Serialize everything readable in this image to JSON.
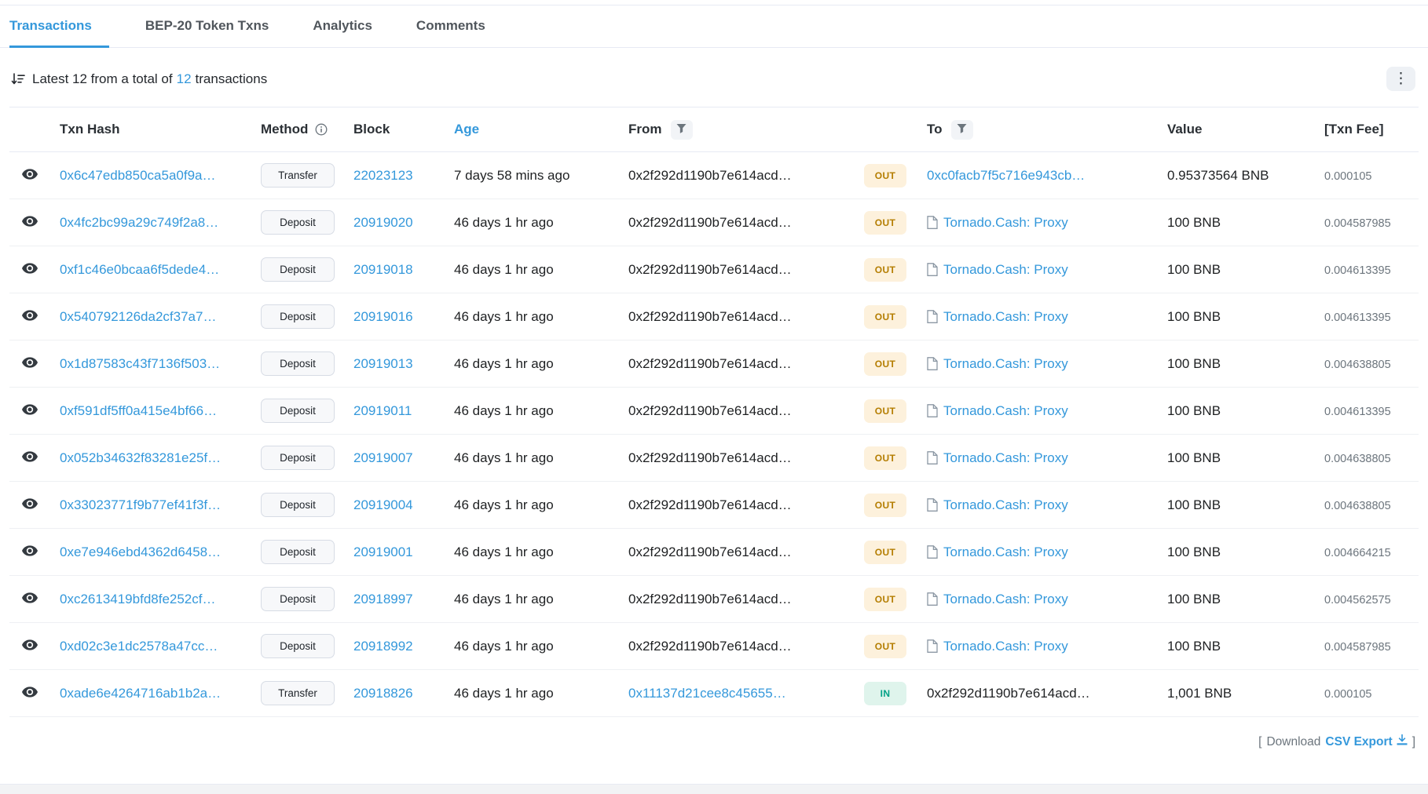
{
  "tabs": [
    {
      "label": "Transactions",
      "active": true
    },
    {
      "label": "BEP-20 Token Txns",
      "active": false
    },
    {
      "label": "Analytics",
      "active": false
    },
    {
      "label": "Comments",
      "active": false
    }
  ],
  "summary": {
    "prefix": "Latest 12 from a total of",
    "count_link": "12",
    "suffix": "transactions"
  },
  "table": {
    "headers": {
      "txn_hash": "Txn Hash",
      "method": "Method",
      "block": "Block",
      "age": "Age",
      "from": "From",
      "to": "To",
      "value": "Value",
      "txn_fee": "[Txn Fee]"
    },
    "rows": [
      {
        "hash": "0x6c47edb850ca5a0f9a…",
        "method": "Transfer",
        "block": "22023123",
        "age": "7 days 58 mins ago",
        "from": "0x2f292d1190b7e614acd…",
        "from_link": false,
        "dir": "OUT",
        "to": "0xc0facb7f5c716e943cb…",
        "to_link": true,
        "to_icon": false,
        "value": "0.95373564 BNB",
        "fee": "0.000105"
      },
      {
        "hash": "0x4fc2bc99a29c749f2a8…",
        "method": "Deposit",
        "block": "20919020",
        "age": "46 days 1 hr ago",
        "from": "0x2f292d1190b7e614acd…",
        "from_link": false,
        "dir": "OUT",
        "to": "Tornado.Cash: Proxy",
        "to_link": true,
        "to_icon": true,
        "value": "100 BNB",
        "fee": "0.004587985"
      },
      {
        "hash": "0xf1c46e0bcaa6f5dede4…",
        "method": "Deposit",
        "block": "20919018",
        "age": "46 days 1 hr ago",
        "from": "0x2f292d1190b7e614acd…",
        "from_link": false,
        "dir": "OUT",
        "to": "Tornado.Cash: Proxy",
        "to_link": true,
        "to_icon": true,
        "value": "100 BNB",
        "fee": "0.004613395"
      },
      {
        "hash": "0x540792126da2cf37a7…",
        "method": "Deposit",
        "block": "20919016",
        "age": "46 days 1 hr ago",
        "from": "0x2f292d1190b7e614acd…",
        "from_link": false,
        "dir": "OUT",
        "to": "Tornado.Cash: Proxy",
        "to_link": true,
        "to_icon": true,
        "value": "100 BNB",
        "fee": "0.004613395"
      },
      {
        "hash": "0x1d87583c43f7136f503…",
        "method": "Deposit",
        "block": "20919013",
        "age": "46 days 1 hr ago",
        "from": "0x2f292d1190b7e614acd…",
        "from_link": false,
        "dir": "OUT",
        "to": "Tornado.Cash: Proxy",
        "to_link": true,
        "to_icon": true,
        "value": "100 BNB",
        "fee": "0.004638805"
      },
      {
        "hash": "0xf591df5ff0a415e4bf66…",
        "method": "Deposit",
        "block": "20919011",
        "age": "46 days 1 hr ago",
        "from": "0x2f292d1190b7e614acd…",
        "from_link": false,
        "dir": "OUT",
        "to": "Tornado.Cash: Proxy",
        "to_link": true,
        "to_icon": true,
        "value": "100 BNB",
        "fee": "0.004613395"
      },
      {
        "hash": "0x052b34632f83281e25f…",
        "method": "Deposit",
        "block": "20919007",
        "age": "46 days 1 hr ago",
        "from": "0x2f292d1190b7e614acd…",
        "from_link": false,
        "dir": "OUT",
        "to": "Tornado.Cash: Proxy",
        "to_link": true,
        "to_icon": true,
        "value": "100 BNB",
        "fee": "0.004638805"
      },
      {
        "hash": "0x33023771f9b77ef41f3f…",
        "method": "Deposit",
        "block": "20919004",
        "age": "46 days 1 hr ago",
        "from": "0x2f292d1190b7e614acd…",
        "from_link": false,
        "dir": "OUT",
        "to": "Tornado.Cash: Proxy",
        "to_link": true,
        "to_icon": true,
        "value": "100 BNB",
        "fee": "0.004638805"
      },
      {
        "hash": "0xe7e946ebd4362d6458…",
        "method": "Deposit",
        "block": "20919001",
        "age": "46 days 1 hr ago",
        "from": "0x2f292d1190b7e614acd…",
        "from_link": false,
        "dir": "OUT",
        "to": "Tornado.Cash: Proxy",
        "to_link": true,
        "to_icon": true,
        "value": "100 BNB",
        "fee": "0.004664215"
      },
      {
        "hash": "0xc2613419bfd8fe252cf…",
        "method": "Deposit",
        "block": "20918997",
        "age": "46 days 1 hr ago",
        "from": "0x2f292d1190b7e614acd…",
        "from_link": false,
        "dir": "OUT",
        "to": "Tornado.Cash: Proxy",
        "to_link": true,
        "to_icon": true,
        "value": "100 BNB",
        "fee": "0.004562575"
      },
      {
        "hash": "0xd02c3e1dc2578a47cc…",
        "method": "Deposit",
        "block": "20918992",
        "age": "46 days 1 hr ago",
        "from": "0x2f292d1190b7e614acd…",
        "from_link": false,
        "dir": "OUT",
        "to": "Tornado.Cash: Proxy",
        "to_link": true,
        "to_icon": true,
        "value": "100 BNB",
        "fee": "0.004587985"
      },
      {
        "hash": "0xade6e4264716ab1b2a…",
        "method": "Transfer",
        "block": "20918826",
        "age": "46 days 1 hr ago",
        "from": "0x11137d21cee8c45655…",
        "from_link": true,
        "dir": "IN",
        "to": "0x2f292d1190b7e614acd…",
        "to_link": false,
        "to_icon": false,
        "value": "1,001 BNB",
        "fee": "0.000105"
      }
    ]
  },
  "footer": {
    "bracket_open": "[",
    "download_label": "Download",
    "csv_label": "CSV Export",
    "bracket_close": "]"
  },
  "colors": {
    "link_blue": "#3498db",
    "out_text": "#b47d00",
    "out_bg": "#fdf1dc",
    "in_text": "#00a186",
    "in_bg": "#dff4ec",
    "border": "#e7eaf3"
  }
}
